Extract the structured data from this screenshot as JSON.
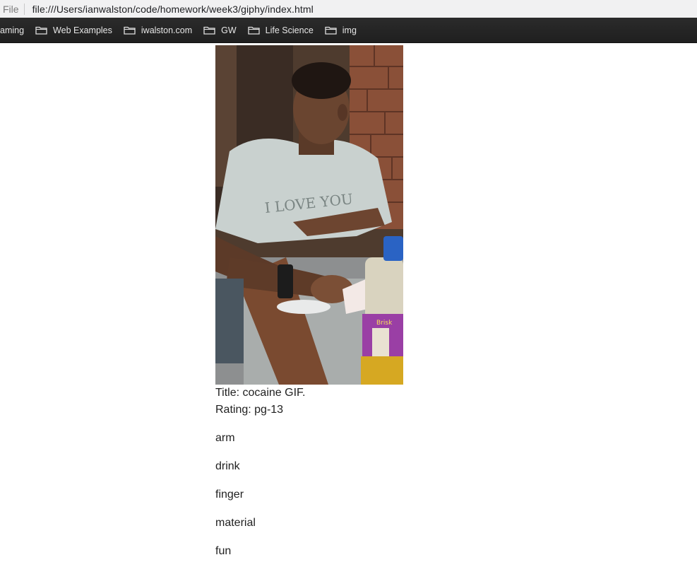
{
  "browser": {
    "scheme_label": "File",
    "url": "file:///Users/ianwalston/code/homework/week3/giphy/index.html"
  },
  "bookmarks": [
    {
      "label": "aming"
    },
    {
      "label": "Web Examples"
    },
    {
      "label": "iwalston.com"
    },
    {
      "label": "GW"
    },
    {
      "label": "Life Science"
    },
    {
      "label": "img"
    }
  ],
  "gif": {
    "title_line": "Title: cocaine GIF.",
    "rating_line": "Rating: pg-13",
    "shirt_text": "I LOVE YOU",
    "bottle_label": "Brisk"
  },
  "tags": [
    "arm",
    "drink",
    "finger",
    "material",
    "fun"
  ],
  "colors": {
    "bookmarks_bar": "#262626",
    "address_bar": "#f1f1f2",
    "text": "#212121"
  }
}
